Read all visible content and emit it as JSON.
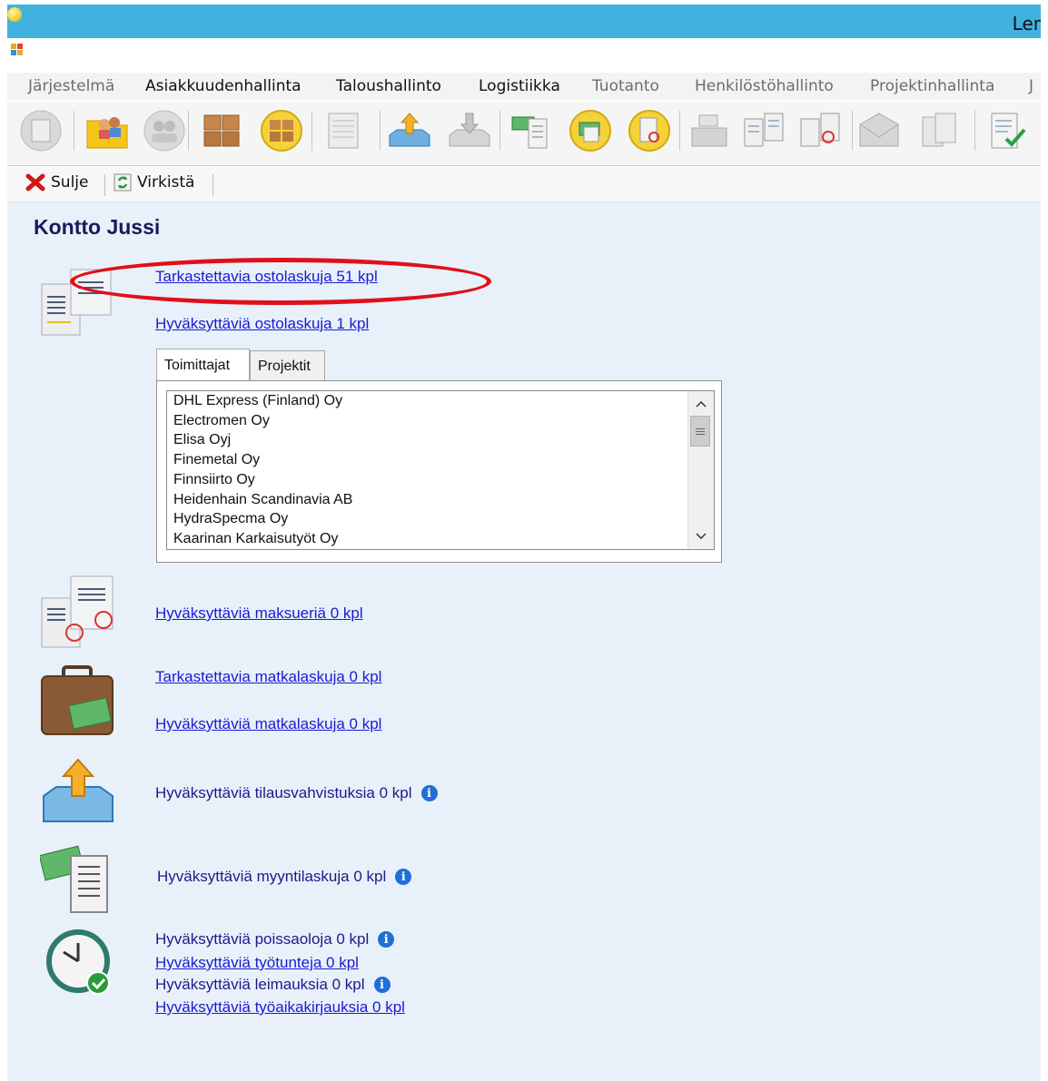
{
  "window": {
    "title": "Ler"
  },
  "menu": {
    "items": [
      {
        "label": "Järjestelmä",
        "enabled": false
      },
      {
        "label": "Asiakkuudenhallinta",
        "enabled": true
      },
      {
        "label": "Taloushallinto",
        "enabled": true
      },
      {
        "label": "Logistiikka",
        "enabled": true
      },
      {
        "label": "Tuotanto",
        "enabled": false
      },
      {
        "label": "Henkilöstöhallinto",
        "enabled": false
      },
      {
        "label": "Projektinhallinta",
        "enabled": false
      },
      {
        "label": "J",
        "enabled": false
      }
    ]
  },
  "toolbar": {
    "icons": [
      "document-icon",
      "folder-people-icon",
      "people-circle-icon",
      "boxes-icon",
      "boxes-circle-icon",
      "ledger-icon",
      "upload-tray-icon",
      "download-tray-icon",
      "money-receipt-icon",
      "money-circle-icon",
      "receipt-circle-icon",
      "cash-register-icon",
      "report-icon",
      "report-chart-icon",
      "envelope-icon",
      "documents-icon",
      "checklist-icon"
    ]
  },
  "commands": {
    "close_label": "Sulje",
    "refresh_label": "Virkistä"
  },
  "page": {
    "title": "Kontto Jussi",
    "links": {
      "purchase_review": "Tarkastettavia ostolaskuja 51 kpl",
      "purchase_approve": "Hyväksyttäviä ostolaskuja 1 kpl",
      "payment_batches": "Hyväksyttäviä maksueriä 0 kpl",
      "travel_review": "Tarkastettavia matkalaskuja 0 kpl",
      "travel_approve": "Hyväksyttäviä matkalaskuja 0 kpl",
      "order_confirmations": "Hyväksyttäviä tilausvahvistuksia 0 kpl",
      "sales_invoices": "Hyväksyttäviä myyntilaskuja 0 kpl",
      "absences": "Hyväksyttäviä poissaoloja 0 kpl",
      "work_hours": "Hyväksyttäviä työtunteja 0 kpl",
      "stamps": "Hyväksyttäviä leimauksia 0 kpl",
      "timesheet_entries": "Hyväksyttäviä työaikakirjauksia 0 kpl"
    },
    "tabs": [
      "Toimittajat",
      "Projektit"
    ],
    "selected_tab": "Toimittajat",
    "suppliers": [
      "DHL Express (Finland) Oy",
      "Electromen Oy",
      "Elisa Oyj",
      "Finemetal Oy",
      "Finnsiirto Oy",
      "Heidenhain Scandinavia AB",
      "HydraSpecma Oy",
      "Kaarinan Karkaisutyöt Oy"
    ],
    "info_icon_glyph": "i"
  },
  "colors": {
    "titlebar": "#3fb2de",
    "content_bg": "#e8f1fa",
    "link": "#1a1ad4",
    "highlight_ellipse": "#e0101a"
  }
}
